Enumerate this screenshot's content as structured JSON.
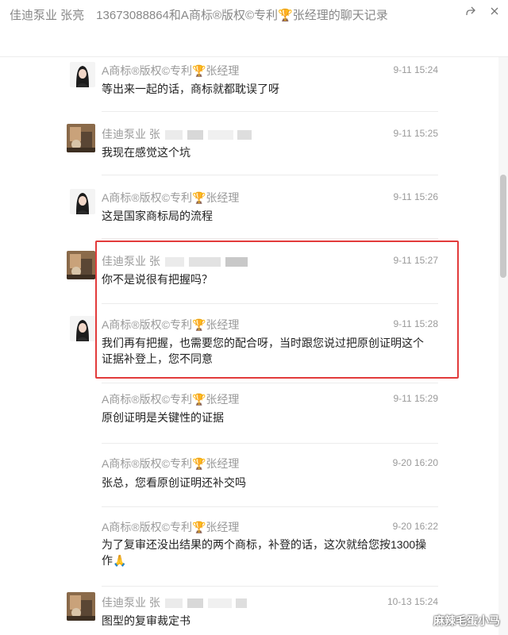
{
  "window": {
    "title": "佳迪泵业 张亮　13673088864和A商标®版权©专利🏆张经理的聊天记录"
  },
  "messages": [
    {
      "sender": "A商标®版权©专利🏆张经理",
      "time": "9-11 15:24",
      "text": "等出来一起的话，商标就都耽误了呀",
      "avatar": "female"
    },
    {
      "sender": "佳迪泵业 张",
      "time": "9-11 15:25",
      "text": "我现在感觉这个坑",
      "avatar": "pump"
    },
    {
      "sender": "A商标®版权©专利🏆张经理",
      "time": "9-11 15:26",
      "text": "这是国家商标局的流程",
      "avatar": "female"
    },
    {
      "sender": "佳迪泵业 张",
      "time": "9-11 15:27",
      "text": "你不是说很有把握吗？",
      "avatar": "pump"
    },
    {
      "sender": "A商标®版权©专利🏆张经理",
      "time": "9-11 15:28",
      "text": "我们再有把握，也需要您的配合呀，当时跟您说过把原创证明这个证据补登上，您不同意",
      "avatar": "female"
    },
    {
      "sender": "A商标®版权©专利🏆张经理",
      "time": "9-11 15:29",
      "text": "原创证明是关键性的证据",
      "avatar": "none"
    },
    {
      "sender": "A商标®版权©专利🏆张经理",
      "time": "9-20 16:20",
      "text": "张总，您看原创证明还补交吗",
      "avatar": "none"
    },
    {
      "sender": "A商标®版权©专利🏆张经理",
      "time": "9-20 16:22",
      "text": "为了复审还没出结果的两个商标，补登的话，这次就给您按1300操作🙏",
      "avatar": "none"
    },
    {
      "sender": "佳迪泵业 张",
      "time": "10-13 15:24",
      "text": "图型的复审裁定书",
      "avatar": "pump"
    }
  ],
  "watermark": "麻辣毛蛋小马",
  "colors": {
    "highlight": "#e23b3b",
    "meta": "#9a9a9a",
    "text": "#222222"
  }
}
